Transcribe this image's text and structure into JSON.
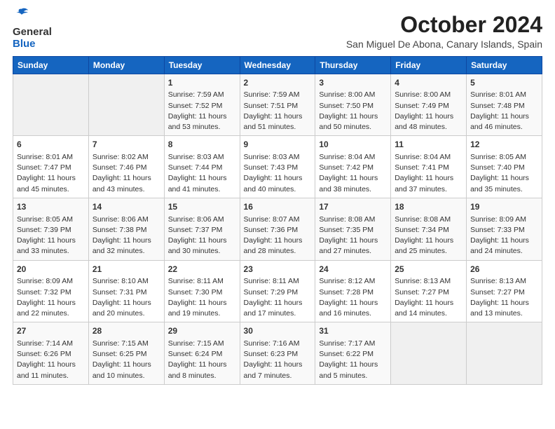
{
  "header": {
    "logo_general": "General",
    "logo_blue": "Blue",
    "month": "October 2024",
    "location": "San Miguel De Abona, Canary Islands, Spain"
  },
  "weekdays": [
    "Sunday",
    "Monday",
    "Tuesday",
    "Wednesday",
    "Thursday",
    "Friday",
    "Saturday"
  ],
  "weeks": [
    [
      {
        "day": "",
        "info": ""
      },
      {
        "day": "",
        "info": ""
      },
      {
        "day": "1",
        "info": "Sunrise: 7:59 AM\nSunset: 7:52 PM\nDaylight: 11 hours and 53 minutes."
      },
      {
        "day": "2",
        "info": "Sunrise: 7:59 AM\nSunset: 7:51 PM\nDaylight: 11 hours and 51 minutes."
      },
      {
        "day": "3",
        "info": "Sunrise: 8:00 AM\nSunset: 7:50 PM\nDaylight: 11 hours and 50 minutes."
      },
      {
        "day": "4",
        "info": "Sunrise: 8:00 AM\nSunset: 7:49 PM\nDaylight: 11 hours and 48 minutes."
      },
      {
        "day": "5",
        "info": "Sunrise: 8:01 AM\nSunset: 7:48 PM\nDaylight: 11 hours and 46 minutes."
      }
    ],
    [
      {
        "day": "6",
        "info": "Sunrise: 8:01 AM\nSunset: 7:47 PM\nDaylight: 11 hours and 45 minutes."
      },
      {
        "day": "7",
        "info": "Sunrise: 8:02 AM\nSunset: 7:46 PM\nDaylight: 11 hours and 43 minutes."
      },
      {
        "day": "8",
        "info": "Sunrise: 8:03 AM\nSunset: 7:44 PM\nDaylight: 11 hours and 41 minutes."
      },
      {
        "day": "9",
        "info": "Sunrise: 8:03 AM\nSunset: 7:43 PM\nDaylight: 11 hours and 40 minutes."
      },
      {
        "day": "10",
        "info": "Sunrise: 8:04 AM\nSunset: 7:42 PM\nDaylight: 11 hours and 38 minutes."
      },
      {
        "day": "11",
        "info": "Sunrise: 8:04 AM\nSunset: 7:41 PM\nDaylight: 11 hours and 37 minutes."
      },
      {
        "day": "12",
        "info": "Sunrise: 8:05 AM\nSunset: 7:40 PM\nDaylight: 11 hours and 35 minutes."
      }
    ],
    [
      {
        "day": "13",
        "info": "Sunrise: 8:05 AM\nSunset: 7:39 PM\nDaylight: 11 hours and 33 minutes."
      },
      {
        "day": "14",
        "info": "Sunrise: 8:06 AM\nSunset: 7:38 PM\nDaylight: 11 hours and 32 minutes."
      },
      {
        "day": "15",
        "info": "Sunrise: 8:06 AM\nSunset: 7:37 PM\nDaylight: 11 hours and 30 minutes."
      },
      {
        "day": "16",
        "info": "Sunrise: 8:07 AM\nSunset: 7:36 PM\nDaylight: 11 hours and 28 minutes."
      },
      {
        "day": "17",
        "info": "Sunrise: 8:08 AM\nSunset: 7:35 PM\nDaylight: 11 hours and 27 minutes."
      },
      {
        "day": "18",
        "info": "Sunrise: 8:08 AM\nSunset: 7:34 PM\nDaylight: 11 hours and 25 minutes."
      },
      {
        "day": "19",
        "info": "Sunrise: 8:09 AM\nSunset: 7:33 PM\nDaylight: 11 hours and 24 minutes."
      }
    ],
    [
      {
        "day": "20",
        "info": "Sunrise: 8:09 AM\nSunset: 7:32 PM\nDaylight: 11 hours and 22 minutes."
      },
      {
        "day": "21",
        "info": "Sunrise: 8:10 AM\nSunset: 7:31 PM\nDaylight: 11 hours and 20 minutes."
      },
      {
        "day": "22",
        "info": "Sunrise: 8:11 AM\nSunset: 7:30 PM\nDaylight: 11 hours and 19 minutes."
      },
      {
        "day": "23",
        "info": "Sunrise: 8:11 AM\nSunset: 7:29 PM\nDaylight: 11 hours and 17 minutes."
      },
      {
        "day": "24",
        "info": "Sunrise: 8:12 AM\nSunset: 7:28 PM\nDaylight: 11 hours and 16 minutes."
      },
      {
        "day": "25",
        "info": "Sunrise: 8:13 AM\nSunset: 7:27 PM\nDaylight: 11 hours and 14 minutes."
      },
      {
        "day": "26",
        "info": "Sunrise: 8:13 AM\nSunset: 7:27 PM\nDaylight: 11 hours and 13 minutes."
      }
    ],
    [
      {
        "day": "27",
        "info": "Sunrise: 7:14 AM\nSunset: 6:26 PM\nDaylight: 11 hours and 11 minutes."
      },
      {
        "day": "28",
        "info": "Sunrise: 7:15 AM\nSunset: 6:25 PM\nDaylight: 11 hours and 10 minutes."
      },
      {
        "day": "29",
        "info": "Sunrise: 7:15 AM\nSunset: 6:24 PM\nDaylight: 11 hours and 8 minutes."
      },
      {
        "day": "30",
        "info": "Sunrise: 7:16 AM\nSunset: 6:23 PM\nDaylight: 11 hours and 7 minutes."
      },
      {
        "day": "31",
        "info": "Sunrise: 7:17 AM\nSunset: 6:22 PM\nDaylight: 11 hours and 5 minutes."
      },
      {
        "day": "",
        "info": ""
      },
      {
        "day": "",
        "info": ""
      }
    ]
  ]
}
